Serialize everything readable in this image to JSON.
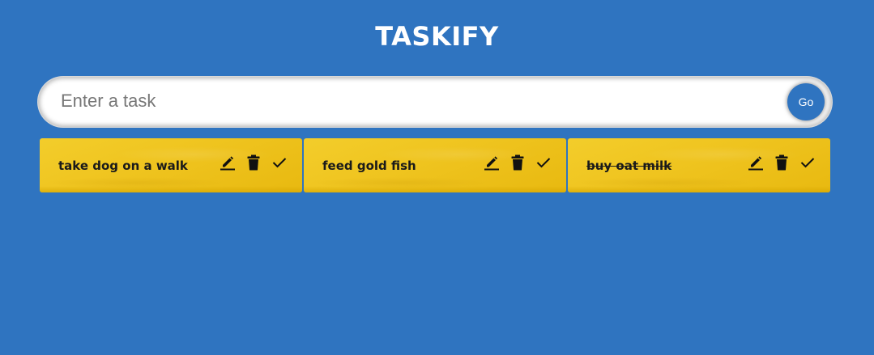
{
  "app": {
    "title": "TASKIFY"
  },
  "input": {
    "placeholder": "Enter a task",
    "value": "",
    "submit_label": "Go"
  },
  "tasks": [
    {
      "text": "take dog on a walk",
      "done": false,
      "icons": [
        "edit-icon",
        "delete-icon",
        "check-icon"
      ]
    },
    {
      "text": "feed gold fish",
      "done": false,
      "icons": [
        "edit-icon",
        "delete-icon",
        "check-icon"
      ]
    },
    {
      "text": "buy oat milk",
      "done": true,
      "icons": [
        "edit-icon",
        "delete-icon",
        "check-icon"
      ]
    }
  ],
  "colors": {
    "background": "#2f74c0",
    "card": "#f0c620",
    "text": "#1a1a1a",
    "title": "#ffffff"
  }
}
